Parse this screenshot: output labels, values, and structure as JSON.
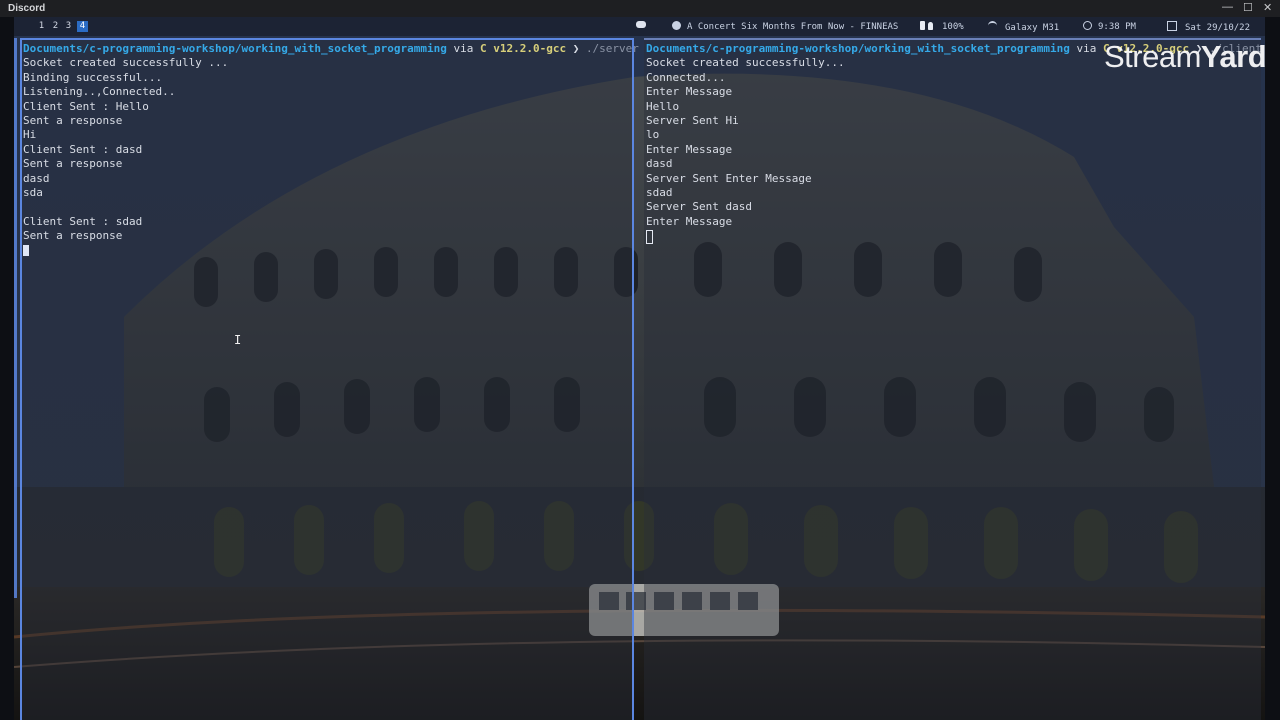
{
  "window": {
    "title": "Discord"
  },
  "statusbar": {
    "workspaces": [
      "1",
      "2",
      "3",
      "4"
    ],
    "active_workspace": "4",
    "song": "A Concert Six Months From Now - FINNEAS",
    "battery": "100%",
    "network": "Galaxy M31",
    "time": "9:38 PM",
    "date": "Sat 29/10/22"
  },
  "left_pane": {
    "prompt": {
      "path": "Documents/c-programming-workshop/working_with_socket_programming",
      "via": "via",
      "lang": "C v12.2.0-gcc",
      "arrow": "❯",
      "command": "./server"
    },
    "lines": [
      "Socket created successfully ...",
      "Binding successful...",
      "Listening..,Connected..",
      "Client Sent : Hello",
      "Sent a response",
      "Hi",
      "Client Sent : dasd",
      "Sent a response",
      "dasd",
      "sda",
      "",
      "Client Sent : sdad",
      "Sent a response"
    ]
  },
  "right_pane": {
    "prompt": {
      "path": "Documents/c-programming-workshop/working_with_socket_programming",
      "via": "via",
      "lang": "C v12.2.0-gcc",
      "arrow": "❯",
      "command": "./client"
    },
    "lines": [
      "Socket created successfully...",
      "Connected...",
      "Enter Message",
      "Hello",
      "Server Sent Hi",
      "lo",
      "Enter Message",
      "dasd",
      "Server Sent Enter Message",
      "sdad",
      "Server Sent dasd",
      "Enter Message"
    ]
  },
  "watermark": {
    "part1": "Stream",
    "part2": "Yard"
  },
  "colors": {
    "accent": "#5b86e0",
    "prompt_path": "#35a9e8",
    "prompt_lang": "#d7cf7a",
    "terminal_text": "#d9dde6"
  }
}
